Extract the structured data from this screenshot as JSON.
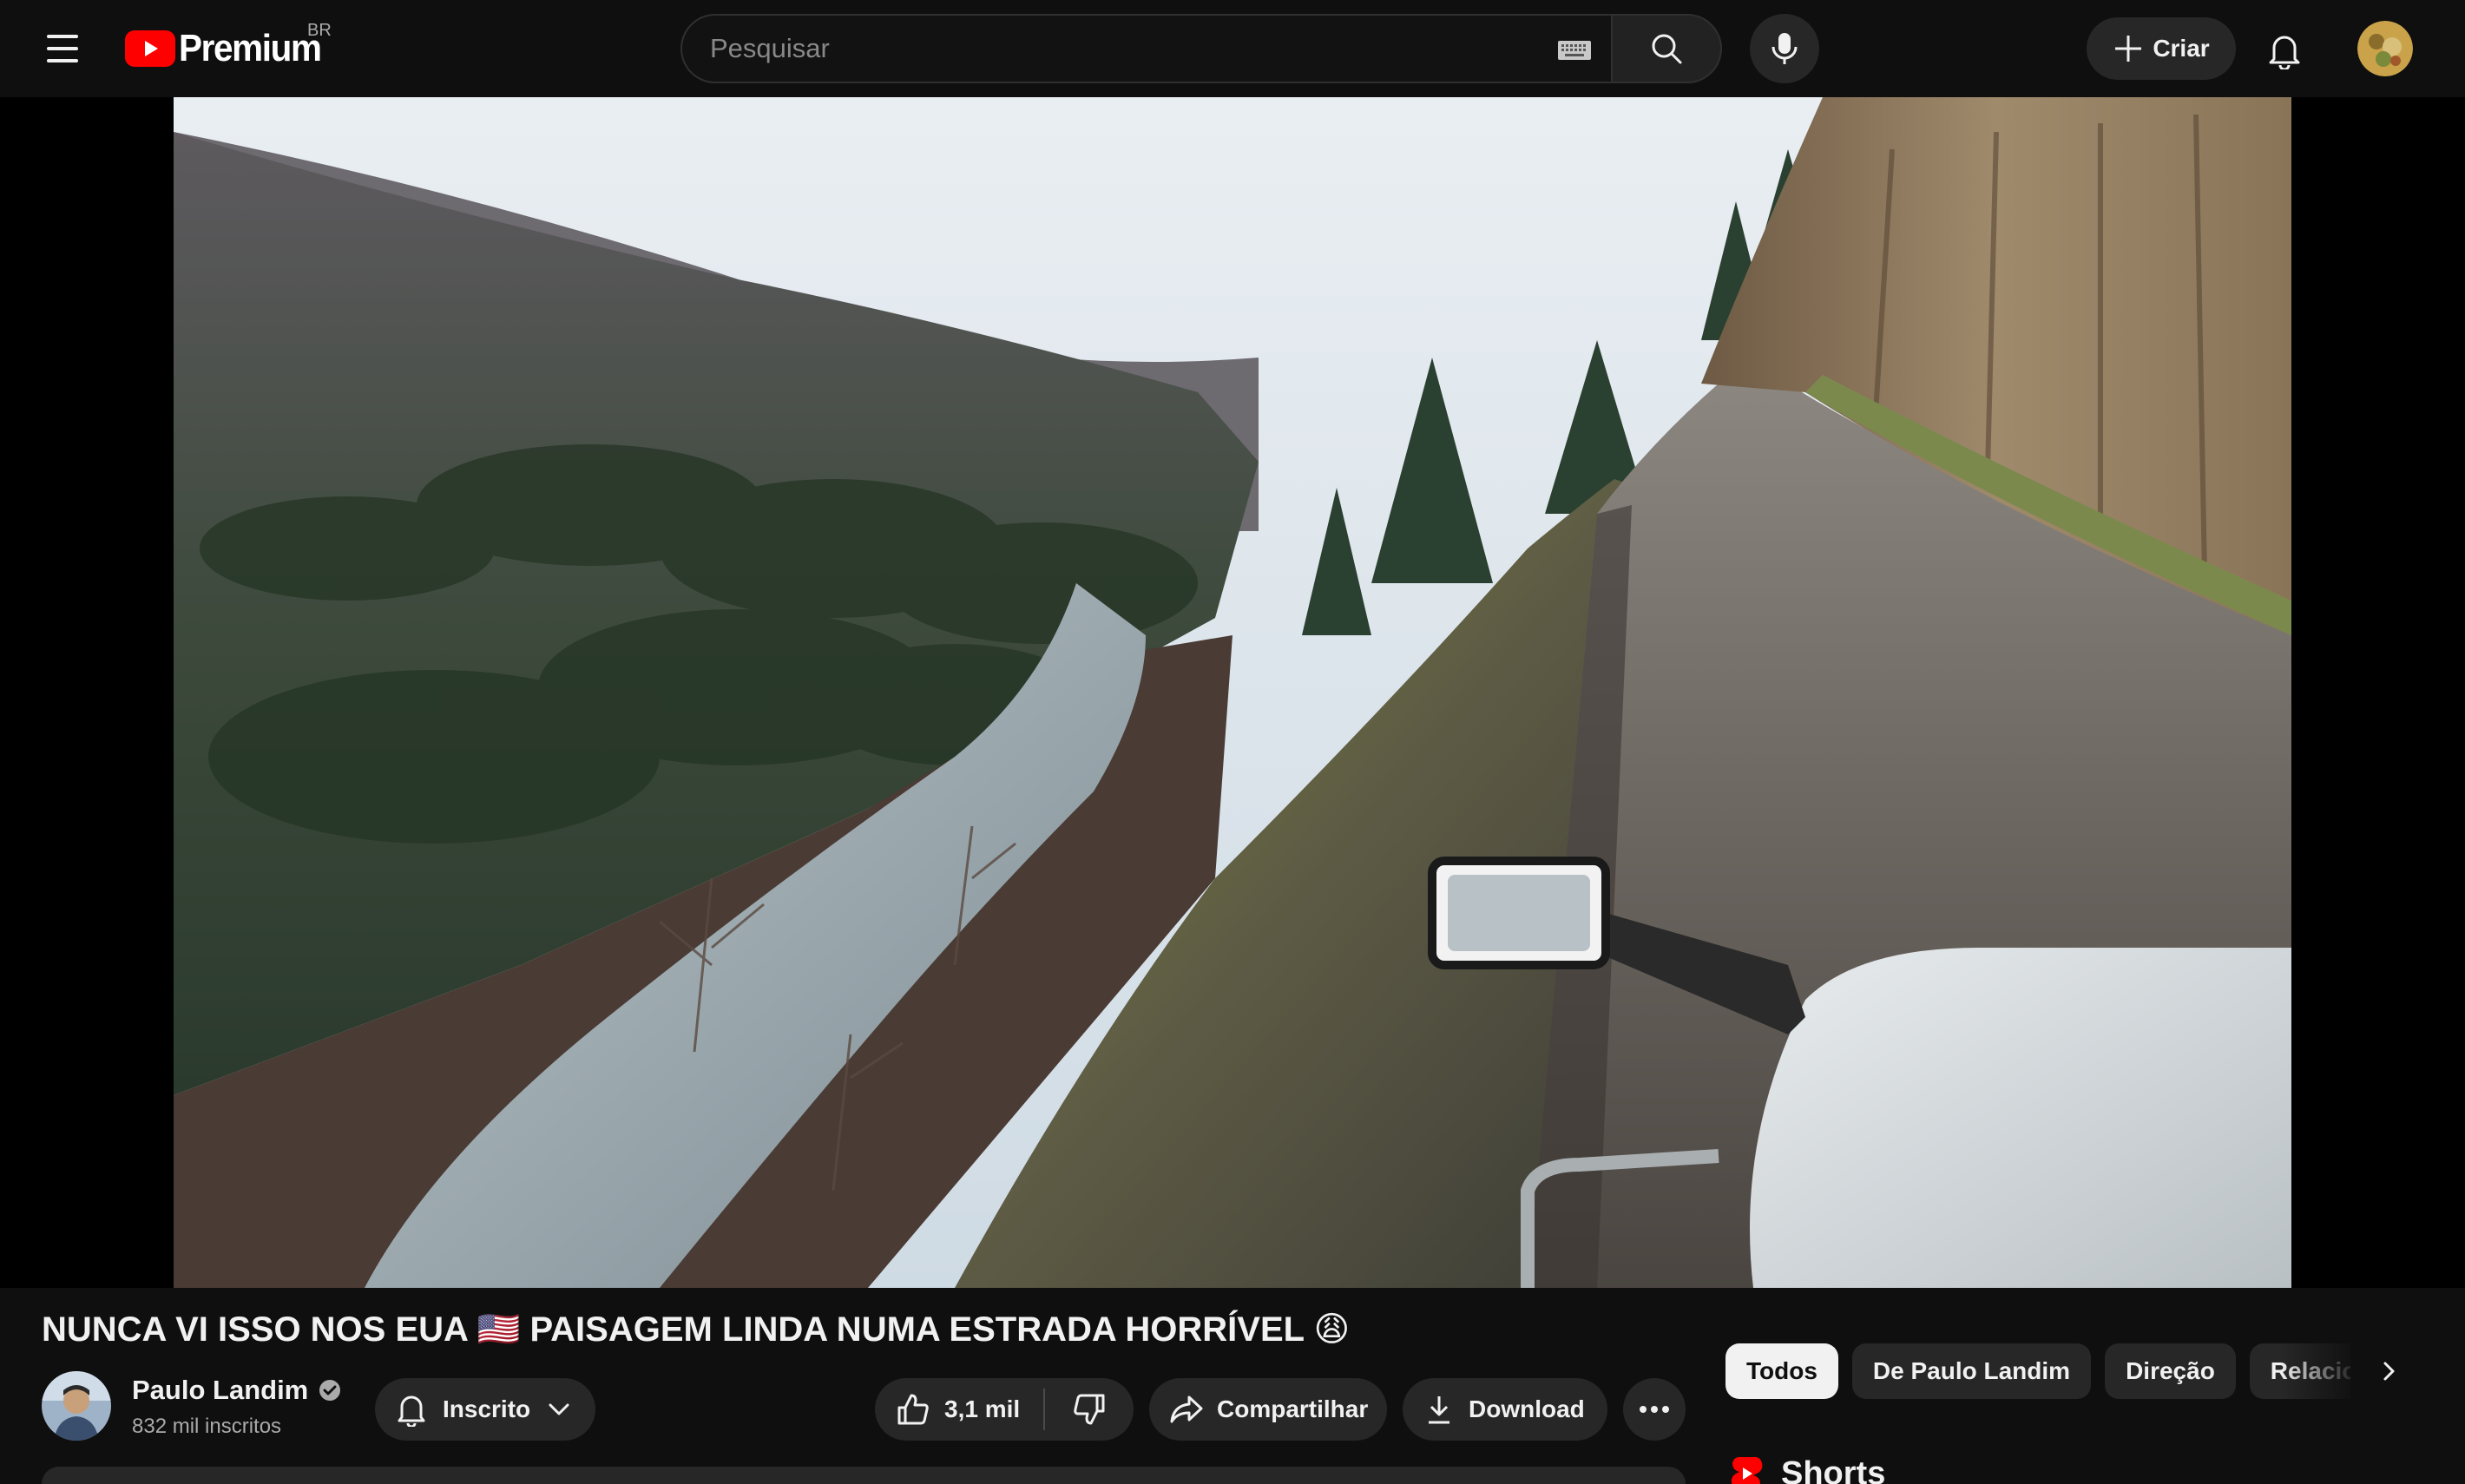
{
  "header": {
    "logo_text": "Premium",
    "country_code": "BR",
    "search_placeholder": "Pesquisar",
    "create_label": "Criar"
  },
  "video": {
    "title": "NUNCA VI ISSO NOS EUA 🇺🇸 PAISAGEM LINDA NUMA ESTRADA HORRÍVEL 😩"
  },
  "channel": {
    "name": "Paulo Landim",
    "subscribers": "832 mil inscritos",
    "subscribed_label": "Inscrito"
  },
  "actions": {
    "like_count": "3,1 mil",
    "share_label": "Compartilhar",
    "download_label": "Download"
  },
  "chips": [
    {
      "label": "Todos"
    },
    {
      "label": "De Paulo Landim"
    },
    {
      "label": "Direção"
    },
    {
      "label": "Relacionados"
    }
  ],
  "sidebar": {
    "shorts_title": "Shorts"
  },
  "colors": {
    "background": "#0f0f0f",
    "surface": "#272727",
    "brand_red": "#ff0000",
    "text_primary": "#f1f1f1",
    "text_secondary": "#aaaaaa"
  }
}
